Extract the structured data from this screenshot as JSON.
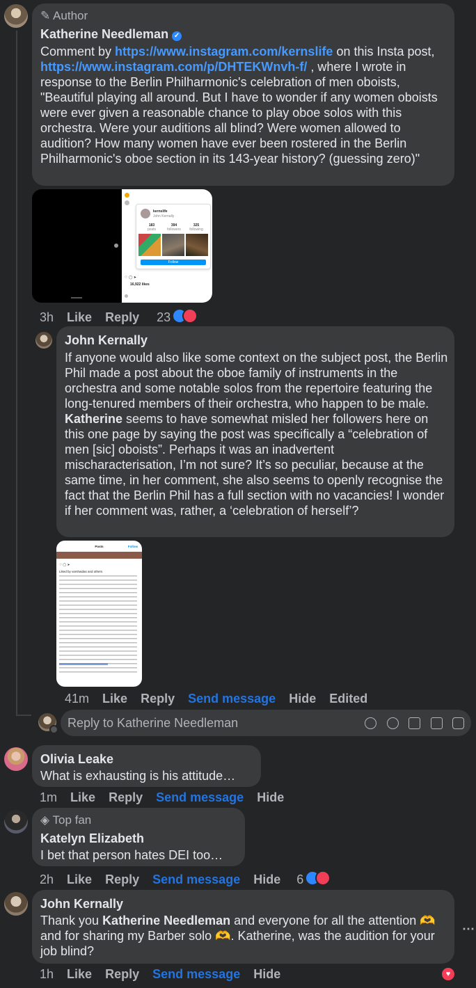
{
  "comment1": {
    "badge": "Author",
    "author": "Katherine Needleman",
    "text_pre": "Comment by ",
    "link1": "https://www.instagram.com/kernslife",
    "text_mid": " on this Insta post, ",
    "link2": "https://www.instagram.com/p/DHTEKWnvh-f/",
    "text_post": " , where I wrote in response to the Berlin Philharmonic's celebration of men oboists, \"Beautiful playing all around. But I have to wonder if any women oboists were ever given a reasonable chance to play oboe solos with this orchestra. Were your auditions all blind? Were women allowed to audition? How many women have ever been rostered in the Berlin Philharmonic's oboe section in its 143-year history? (guessing zero)\"",
    "time": "3h",
    "like": "Like",
    "reply": "Reply",
    "reactions": "23",
    "screenshot": {
      "profile_name": "kernslife",
      "profile_sub": "John Kernally",
      "stats": [
        {
          "value": "183",
          "label": "posts"
        },
        {
          "value": "394",
          "label": "followers"
        },
        {
          "value": "325",
          "label": "following"
        }
      ],
      "follow_label": "Follow",
      "likes_text": "16,922 likes"
    }
  },
  "reply1": {
    "author": "John Kernally",
    "text_a": "If anyone would also like some context on the subject post, the Berlin Phil made a post about the oboe family of instruments in the orchestra and some notable solos from the repertoire featuring the long-tenured members of their orchestra, who happen to be male. ",
    "mention": "Katherine",
    "text_b": " seems to have somewhat misled her followers here on this one page by saying the post was specifically a “celebration of men [sic] oboists”. Perhaps it was an inadvertent mischaracterisation, I’m not sure? It’s so peculiar, because at the same time, in her comment, she also seems to openly recognise the fact that the Berlin Phil has a full section with no vacancies! I wonder if her comment was, rather, a ‘celebration of herself’?",
    "time": "41m",
    "like": "Like",
    "reply": "Reply",
    "send": "Send message",
    "hide": "Hide",
    "edited": "Edited",
    "screenshot": {
      "header": "Posts",
      "follow": "Follow",
      "likes": "Liked by varshaidas and others"
    }
  },
  "reply_box": {
    "placeholder": "Reply to Katherine Needleman"
  },
  "comment2": {
    "author": "Olivia Leake",
    "text": "What is exhausting is his attitude…",
    "time": "1m",
    "like": "Like",
    "reply": "Reply",
    "send": "Send message",
    "hide": "Hide"
  },
  "comment3": {
    "badge": "Top fan",
    "author": "Katelyn Elizabeth",
    "text": "I bet that person hates DEI too…",
    "time": "2h",
    "like": "Like",
    "reply": "Reply",
    "send": "Send message",
    "hide": "Hide",
    "reactions": "6"
  },
  "comment4": {
    "author": "John Kernally",
    "text_a": "Thank you ",
    "mention": "Katherine Needleman",
    "text_b": " and everyone for all the attention 🫶 and for sharing my Barber solo 🫶. Katherine, was the audition for your job blind?",
    "time": "1h",
    "like": "Like",
    "reply": "Reply",
    "send": "Send message",
    "hide": "Hide"
  },
  "colors": {
    "background": "#242526",
    "bubble": "#3a3b3c",
    "link": "#4599ff",
    "send_message": "#2374e1",
    "like_reaction": "#2d88ff",
    "love_reaction": "#f33e58"
  }
}
